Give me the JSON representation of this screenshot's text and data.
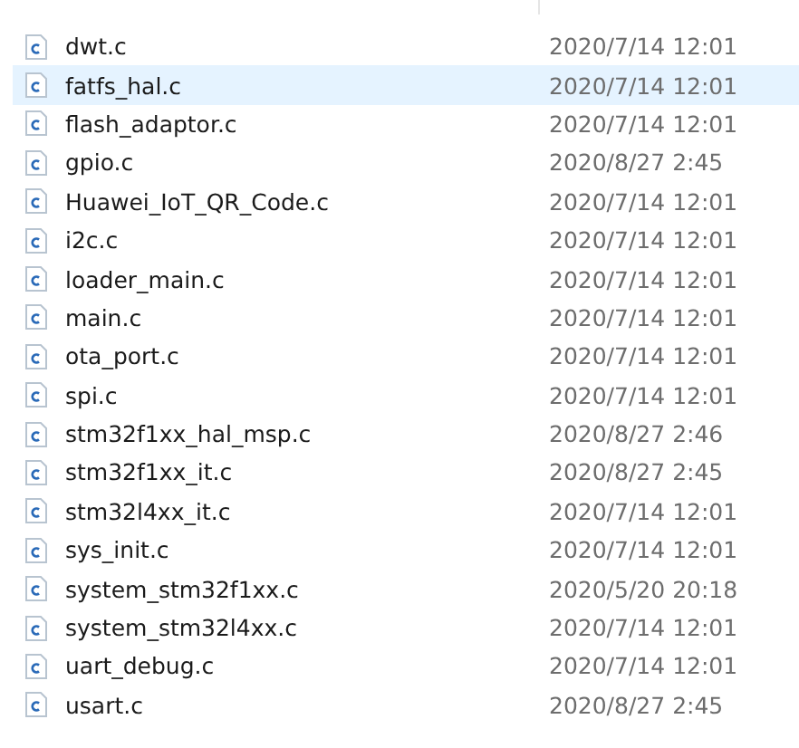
{
  "files": [
    {
      "name": "dwt.c",
      "modified": "2020/7/14 12:01",
      "selected": false
    },
    {
      "name": "fatfs_hal.c",
      "modified": "2020/7/14 12:01",
      "selected": true
    },
    {
      "name": "flash_adaptor.c",
      "modified": "2020/7/14 12:01",
      "selected": false
    },
    {
      "name": "gpio.c",
      "modified": "2020/8/27 2:45",
      "selected": false
    },
    {
      "name": "Huawei_IoT_QR_Code.c",
      "modified": "2020/7/14 12:01",
      "selected": false
    },
    {
      "name": "i2c.c",
      "modified": "2020/7/14 12:01",
      "selected": false
    },
    {
      "name": "loader_main.c",
      "modified": "2020/7/14 12:01",
      "selected": false
    },
    {
      "name": "main.c",
      "modified": "2020/7/14 12:01",
      "selected": false
    },
    {
      "name": "ota_port.c",
      "modified": "2020/7/14 12:01",
      "selected": false
    },
    {
      "name": "spi.c",
      "modified": "2020/7/14 12:01",
      "selected": false
    },
    {
      "name": "stm32f1xx_hal_msp.c",
      "modified": "2020/8/27 2:46",
      "selected": false
    },
    {
      "name": "stm32f1xx_it.c",
      "modified": "2020/8/27 2:45",
      "selected": false
    },
    {
      "name": "stm32l4xx_it.c",
      "modified": "2020/7/14 12:01",
      "selected": false
    },
    {
      "name": "sys_init.c",
      "modified": "2020/7/14 12:01",
      "selected": false
    },
    {
      "name": "system_stm32f1xx.c",
      "modified": "2020/5/20 20:18",
      "selected": false
    },
    {
      "name": "system_stm32l4xx.c",
      "modified": "2020/7/14 12:01",
      "selected": false
    },
    {
      "name": "uart_debug.c",
      "modified": "2020/7/14 12:01",
      "selected": false
    },
    {
      "name": "usart.c",
      "modified": "2020/8/27 2:45",
      "selected": false
    }
  ]
}
